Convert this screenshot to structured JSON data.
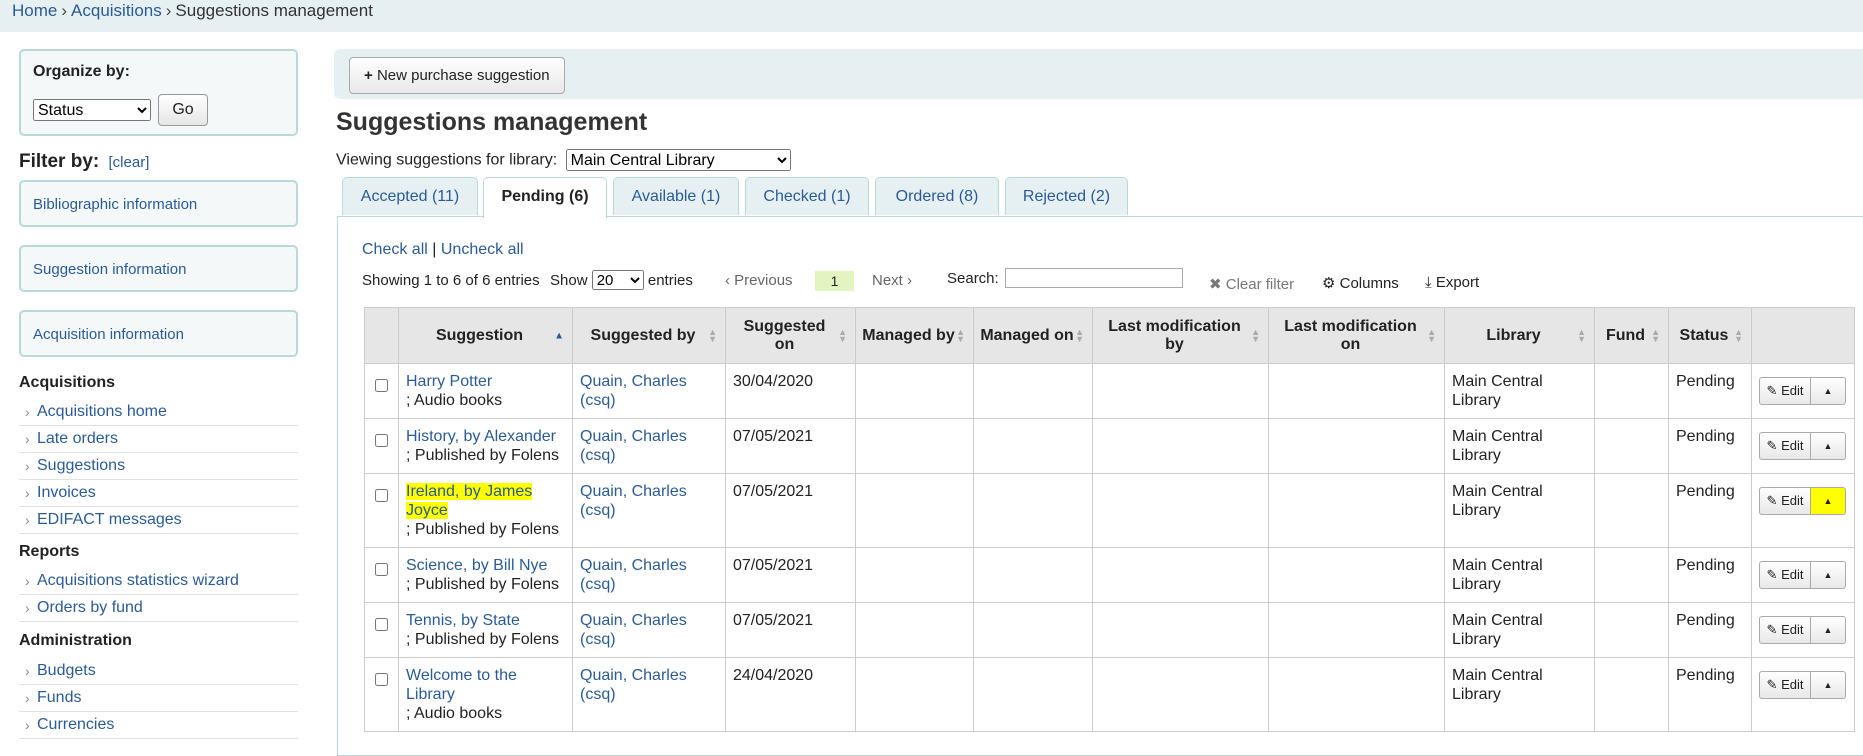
{
  "breadcrumb": {
    "home": "Home",
    "acquisitions": "Acquisitions",
    "current": "Suggestions management",
    "sep": "›"
  },
  "sidebar": {
    "organize_label": "Organize by:",
    "organize_value": "Status",
    "go_label": "Go",
    "filter_title": "Filter by:",
    "filter_clear": "[clear]",
    "filters": [
      "Bibliographic information",
      "Suggestion information",
      "Acquisition information"
    ],
    "sections": [
      {
        "title": "Acquisitions",
        "items": [
          "Acquisitions home",
          "Late orders",
          "Suggestions",
          "Invoices",
          "EDIFACT messages"
        ]
      },
      {
        "title": "Reports",
        "items": [
          "Acquisitions statistics wizard",
          "Orders by fund"
        ]
      },
      {
        "title": "Administration",
        "items": [
          "Budgets",
          "Funds",
          "Currencies"
        ]
      }
    ]
  },
  "toolbar": {
    "new_label": "New purchase suggestion"
  },
  "page": {
    "title": "Suggestions management",
    "viewing_label": "Viewing suggestions for library:",
    "library_value": "Main Central Library"
  },
  "tabs": [
    "Accepted (11)",
    "Pending (6)",
    "Available (1)",
    "Checked (1)",
    "Ordered (8)",
    "Rejected (2)"
  ],
  "table_controls": {
    "check_all": "Check all",
    "bar": "|",
    "uncheck_all": "Uncheck all",
    "showing": "Showing 1 to 6 of 6 entries",
    "show_label": "Show",
    "show_value": "20",
    "entries_label": "entries",
    "previous": "Previous",
    "page": "1",
    "next": "Next",
    "search_label": "Search:",
    "clear_filter": "Clear filter",
    "columns": "Columns",
    "export": "Export"
  },
  "table": {
    "headers": [
      "Suggestion",
      "Suggested by",
      "Suggested on",
      "Managed by",
      "Managed on",
      "Last modification by",
      "Last modification on",
      "Library",
      "Fund",
      "Status"
    ],
    "edit_label": "Edit",
    "rows": [
      {
        "title": "Harry Potter",
        "sub": "; Audio books",
        "by": "Quain, Charles (csq)",
        "on": "30/04/2020",
        "library": "Main Central Library",
        "status": "Pending"
      },
      {
        "title": "History, by Alexander",
        "sub": "; Published by Folens",
        "by": "Quain, Charles (csq)",
        "on": "07/05/2021",
        "library": "Main Central Library",
        "status": "Pending"
      },
      {
        "title": "Ireland, by James Joyce",
        "sub": "; Published by Folens",
        "by": "Quain, Charles (csq)",
        "on": "07/05/2021",
        "library": "Main Central Library",
        "status": "Pending"
      },
      {
        "title": "Science, by Bill Nye",
        "sub": "; Published by Folens",
        "by": "Quain, Charles (csq)",
        "on": "07/05/2021",
        "library": "Main Central Library",
        "status": "Pending"
      },
      {
        "title": "Tennis, by State",
        "sub": "; Published by Folens",
        "by": "Quain, Charles (csq)",
        "on": "07/05/2021",
        "library": "Main Central Library",
        "status": "Pending"
      },
      {
        "title": "Welcome to the Library",
        "sub": "; Audio books",
        "by": "Quain, Charles (csq)",
        "on": "24/04/2020",
        "library": "Main Central Library",
        "status": "Pending"
      }
    ]
  }
}
